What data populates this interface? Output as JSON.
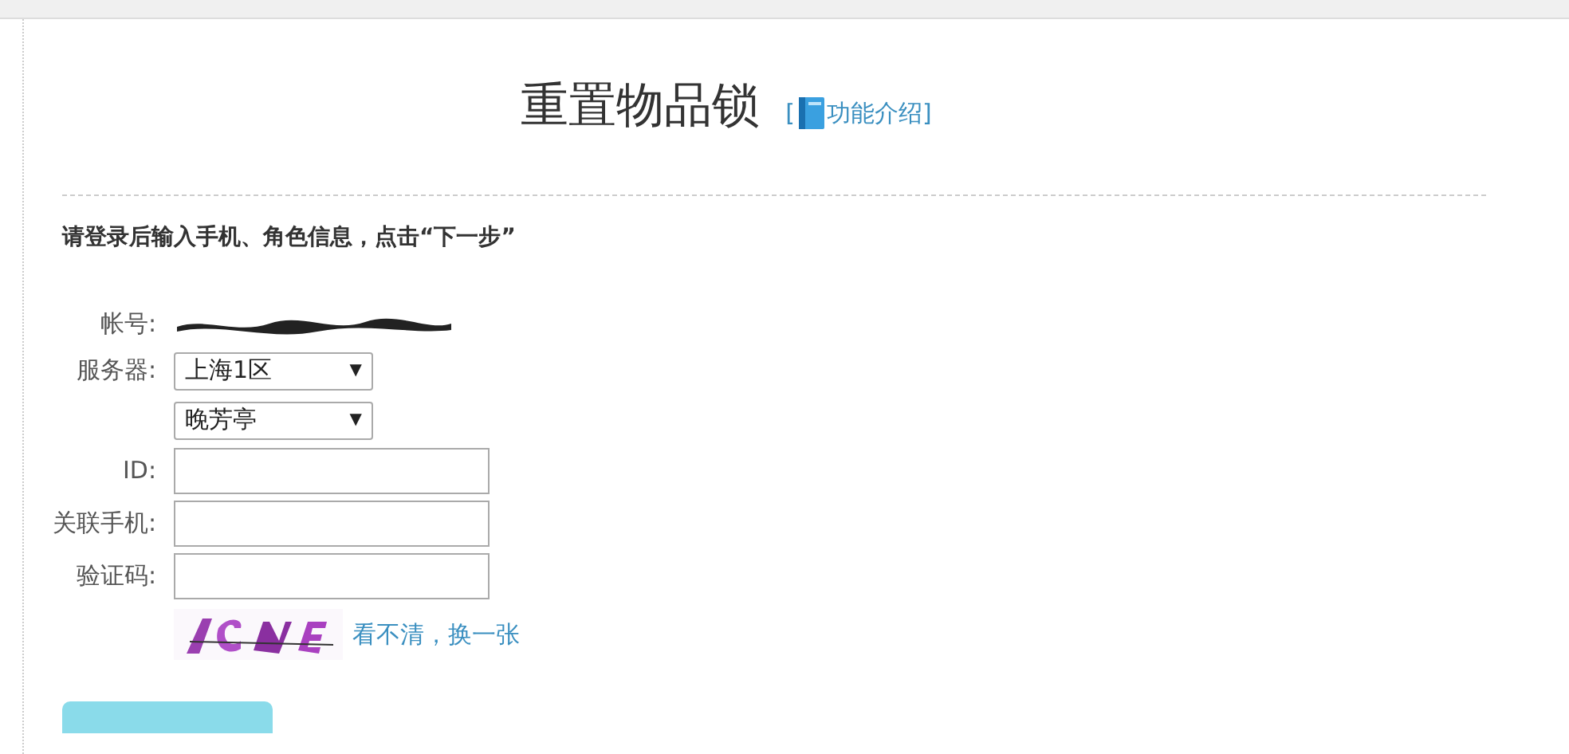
{
  "title": "重置物品锁",
  "help_link": {
    "open_bracket": "[",
    "label": "功能介绍",
    "close_bracket": "]"
  },
  "instruction": "请登录后输入手机、角色信息，点击“下一步”",
  "form": [
    {
      "kind": "redacted",
      "label": "帐号:"
    },
    {
      "kind": "select",
      "label": "服务器:",
      "value": "上海1区",
      "arrow": "▼"
    },
    {
      "kind": "select",
      "value": "晚芳亭",
      "arrow": "▼"
    },
    {
      "kind": "input",
      "label": "ID:"
    },
    {
      "kind": "input",
      "label": "关联手机:"
    },
    {
      "kind": "input",
      "label": "验证码:"
    },
    {
      "kind": "captcha",
      "link": "看不清，换一张"
    }
  ]
}
